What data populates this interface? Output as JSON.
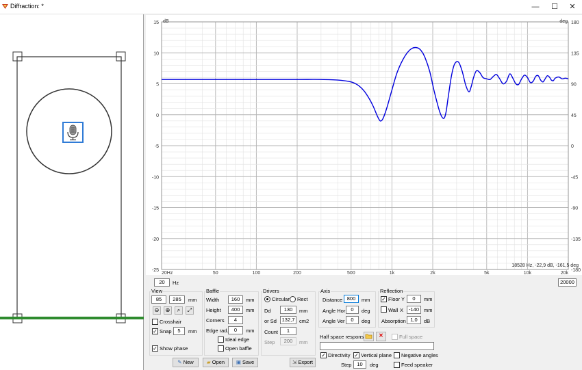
{
  "window": {
    "title": "Diffraction: *",
    "minimize": "—",
    "maximize": "☐",
    "close": "✕"
  },
  "chart_data": {
    "type": "line",
    "xscale": "log",
    "xlim": [
      20,
      20000
    ],
    "ylim": [
      -25,
      15
    ],
    "y2lim": [
      -180,
      180
    ],
    "grid": true,
    "x_ticks": [
      {
        "v": 20,
        "label": "20Hz"
      },
      {
        "v": 50,
        "label": "50"
      },
      {
        "v": 100,
        "label": "100"
      },
      {
        "v": 200,
        "label": "200"
      },
      {
        "v": 500,
        "label": "500"
      },
      {
        "v": 1000,
        "label": "1k"
      },
      {
        "v": 2000,
        "label": "2k"
      },
      {
        "v": 5000,
        "label": "5k"
      },
      {
        "v": 10000,
        "label": "10k"
      },
      {
        "v": 20000,
        "label": "20k"
      }
    ],
    "y_ticks": [
      "15",
      "10",
      "5",
      "0",
      "-5",
      "-10",
      "-15",
      "-20",
      "-25"
    ],
    "y_unit": "dB",
    "y2_ticks": [
      "180",
      "135",
      "90",
      "45",
      "0",
      "-45",
      "-90",
      "-135",
      "-180"
    ],
    "y2_unit": "deg",
    "cursor_readout": "18528 Hz, -22,9 dB, -161,5 deg",
    "series": [
      {
        "color": "#0000dd",
        "x": [
          20,
          50,
          100,
          200,
          300,
          400,
          500,
          560,
          620,
          680,
          730,
          780,
          820,
          860,
          920,
          1000,
          1100,
          1250,
          1400,
          1550,
          1650,
          1750,
          1900,
          2050,
          2250,
          2400,
          2500,
          2600,
          2750,
          2900,
          3100,
          3300,
          3500,
          3700,
          3850,
          4000,
          4200,
          4450,
          4700,
          5000,
          5300,
          5600,
          5900,
          6200,
          6600,
          7000,
          7400,
          7800,
          8200,
          8600,
          9000,
          9500,
          10000,
          10500,
          11000,
          11500,
          12000,
          12500,
          13000,
          13500,
          14000,
          14500,
          15000,
          15500,
          16000,
          17000,
          18000,
          19000,
          20000
        ],
        "y": [
          5.7,
          5.7,
          5.7,
          5.7,
          5.7,
          5.6,
          5.3,
          4.8,
          3.9,
          2.6,
          1.3,
          -0.2,
          -1.0,
          -0.6,
          1.2,
          4.0,
          7.0,
          9.5,
          10.7,
          10.8,
          10.3,
          9.3,
          7.0,
          3.8,
          0.5,
          -0.6,
          0.3,
          2.8,
          6.3,
          8.2,
          8.5,
          7.0,
          4.8,
          3.7,
          4.6,
          6.0,
          7.1,
          6.8,
          6.0,
          5.8,
          5.7,
          6.2,
          6.5,
          5.9,
          5.0,
          5.4,
          6.6,
          5.9,
          5.0,
          4.9,
          5.7,
          6.4,
          6.0,
          5.2,
          5.4,
          6.2,
          6.3,
          5.6,
          5.3,
          5.8,
          6.3,
          6.1,
          5.6,
          5.5,
          5.9,
          6.1,
          5.8,
          5.9,
          5.8
        ]
      }
    ]
  },
  "freq_range": {
    "min": "20",
    "unit": "Hz",
    "max": "20000"
  },
  "view": {
    "title": "View",
    "x": "85",
    "y": "285",
    "unit": "mm",
    "crosshair": "Crosshair",
    "snap": "Snap",
    "snap_value": "5",
    "snap_unit": "mm",
    "show_phase": "Show phase"
  },
  "baffle": {
    "title": "Baffle",
    "width_label": "Width",
    "width": "160",
    "height_label": "Height",
    "height": "400",
    "corners_label": "Corners",
    "corners": "4",
    "edge_label": "Edge rad.",
    "edge": "0",
    "unit": "mm",
    "ideal_edge": "Ideal edge",
    "open_baffle": "Open baffle"
  },
  "drivers": {
    "title": "Drivers",
    "circular": "Circular",
    "rect": "Rect",
    "dd_label": "Dd",
    "dd": "130",
    "dd_unit": "mm",
    "sd_label": "or Sd",
    "sd": "132,7",
    "sd_unit": "cm2",
    "count_label": "Count",
    "count": "1",
    "step_label": "Step",
    "step": "200",
    "step_unit": "mm"
  },
  "axis": {
    "title": "Axis",
    "distance_label": "Distance",
    "distance": "800",
    "distance_unit": "mm",
    "angle_hor_label": "Angle Hor",
    "angle_hor": "0",
    "angle_ver_label": "Angle Ver",
    "angle_ver": "0",
    "deg": "deg"
  },
  "reflection": {
    "title": "Reflection",
    "floor_label": "Floor Y",
    "floor": "0",
    "wall_label": "Wall",
    "wall_x": "X",
    "wall": "-140",
    "unit": "mm",
    "absorption_label": "Absorption",
    "absorption": "1,0",
    "absorption_unit": "dB"
  },
  "half_space": {
    "label": "Half space response",
    "full_space": "Full space",
    "path": ""
  },
  "options": {
    "directivity": "Directivity",
    "vertical_plane": "Vertical plane",
    "negative_angles": "Negative angles",
    "feed_speaker": "Feed speaker",
    "step_label": "Step",
    "step": "10",
    "step_unit": "deg"
  },
  "buttons": {
    "new": "New",
    "open": "Open",
    "save": "Save",
    "export": "Export"
  }
}
